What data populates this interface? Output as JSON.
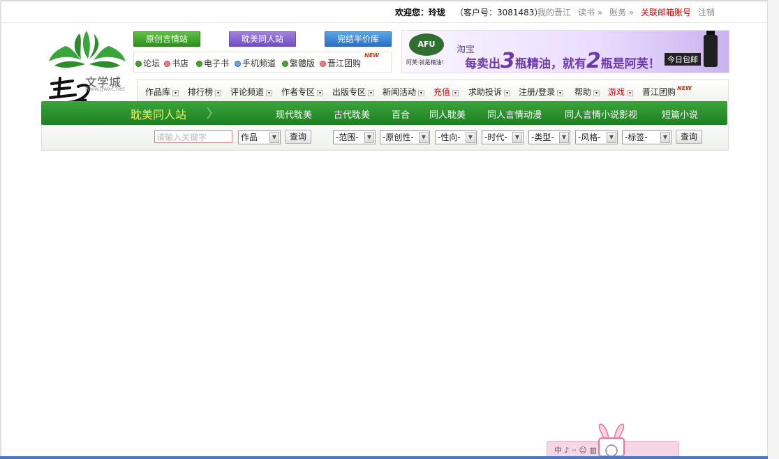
{
  "userbar": {
    "welcome": "欢迎您：玲珑",
    "customer_no": "（客户号：3081483）",
    "my_jinjiang": "我的晋江",
    "reading": "读书 »",
    "account": "账务 »",
    "link_email": "关联邮箱账号",
    "logout": "注销"
  },
  "logo": {
    "text_small": "文学城",
    "url": "www.jjwxc.net"
  },
  "top_buttons": {
    "original": "原创言情站",
    "danmei": "耽美同人站",
    "completed": "完结半价库"
  },
  "link_row": {
    "forum": "论坛",
    "store": "书店",
    "ebook": "电子书",
    "mobile": "手机频道",
    "traditional": "繁體版",
    "groupbuy": "晋江团购",
    "new": "NEW"
  },
  "banner": {
    "brand": "AFU",
    "brand_sub": "阿芙·就是精油!",
    "taobao": "淘宝",
    "slogan_a": "每卖出",
    "num_a": "3",
    "slogan_b": "瓶精油，就有",
    "num_b": "2",
    "slogan_c": "瓶是阿芙！",
    "today": "今日包邮"
  },
  "menu": {
    "works": "作品库",
    "ranking": "排行榜",
    "review": "评论频道",
    "author": "作者专区",
    "publish": "出版专区",
    "news": "新闻活动",
    "recharge": "充值",
    "help_complaint": "求助投诉",
    "register": "注册/登录",
    "help": "帮助",
    "game": "游戏",
    "groupbuy": "晋江团购",
    "new": "NEW"
  },
  "greennav": {
    "title": "耽美同人站",
    "items": [
      "现代耽美",
      "古代耽美",
      "百合",
      "同人耽美",
      "同人言情动漫",
      "同人言情小说影视",
      "短篇小说"
    ]
  },
  "search": {
    "placeholder": "请输入关键字",
    "type": "作品",
    "query": "查询",
    "filters": [
      "-范围-",
      "-原创性-",
      "-性向-",
      "-时代-",
      "-类型-",
      "-风格-",
      "-标签-"
    ],
    "query2": "查询"
  },
  "widget": {
    "text": "中 ♪ ·· ☺ ▥ ♣ ✎"
  },
  "colors": {
    "nav_green": "#1f7f23",
    "nav_title": "#e6f26a",
    "red_link": "#c00000"
  }
}
